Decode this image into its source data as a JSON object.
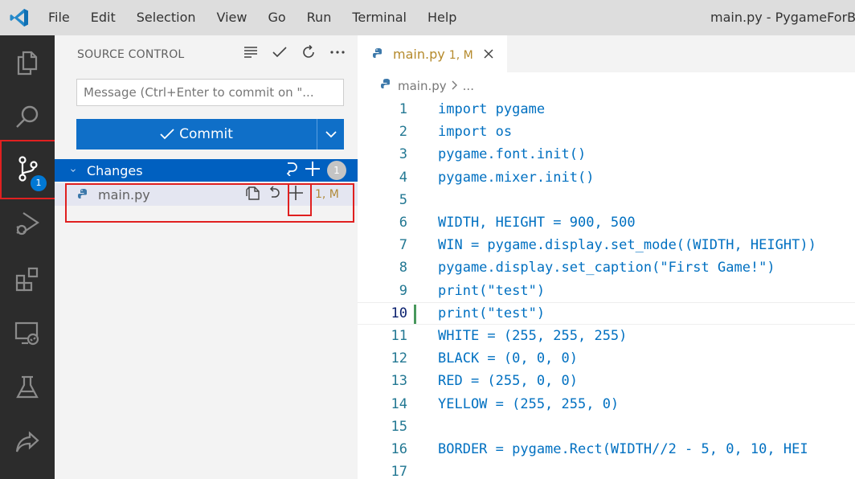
{
  "titlebar": {
    "menu": [
      "File",
      "Edit",
      "Selection",
      "View",
      "Go",
      "Run",
      "Terminal",
      "Help"
    ],
    "window_title": "main.py - PygameForBe"
  },
  "activity_bar": {
    "icons": [
      "explorer-icon",
      "search-icon",
      "source-control-icon",
      "run-debug-icon",
      "extensions-icon",
      "remote-explorer-icon",
      "testing-icon",
      "live-share-icon"
    ],
    "source_control_badge": "1",
    "accent_color": "#0078d4"
  },
  "sidebar": {
    "title": "SOURCE CONTROL",
    "message_placeholder": "Message (Ctrl+Enter to commit on \"...",
    "commit_label": "Commit",
    "changes_label": "Changes",
    "changes_count": "1",
    "file": {
      "name": "main.py",
      "status": "1, M"
    }
  },
  "editor": {
    "tab": {
      "label": "main.py",
      "status": "1, M"
    },
    "breadcrumb": {
      "file": "main.py",
      "more": "..."
    },
    "current_line": 10,
    "lines": [
      {
        "n": "1",
        "text": "import pygame"
      },
      {
        "n": "2",
        "text": "import os"
      },
      {
        "n": "3",
        "text": "pygame.font.init()"
      },
      {
        "n": "4",
        "text": "pygame.mixer.init()"
      },
      {
        "n": "5",
        "text": ""
      },
      {
        "n": "6",
        "text": "WIDTH, HEIGHT = 900, 500"
      },
      {
        "n": "7",
        "text": "WIN = pygame.display.set_mode((WIDTH, HEIGHT))"
      },
      {
        "n": "8",
        "text": "pygame.display.set_caption(\"First Game!\")"
      },
      {
        "n": "9",
        "text": "print(\"test\")"
      },
      {
        "n": "10",
        "text": "print(\"test\")"
      },
      {
        "n": "11",
        "text": "WHITE = (255, 255, 255)"
      },
      {
        "n": "12",
        "text": "BLACK = (0, 0, 0)"
      },
      {
        "n": "13",
        "text": "RED = (255, 0, 0)"
      },
      {
        "n": "14",
        "text": "YELLOW = (255, 255, 0)"
      },
      {
        "n": "15",
        "text": ""
      },
      {
        "n": "16",
        "text": "BORDER = pygame.Rect(WIDTH//2 - 5, 0, 10, HEI"
      },
      {
        "n": "17",
        "text": ""
      }
    ]
  }
}
